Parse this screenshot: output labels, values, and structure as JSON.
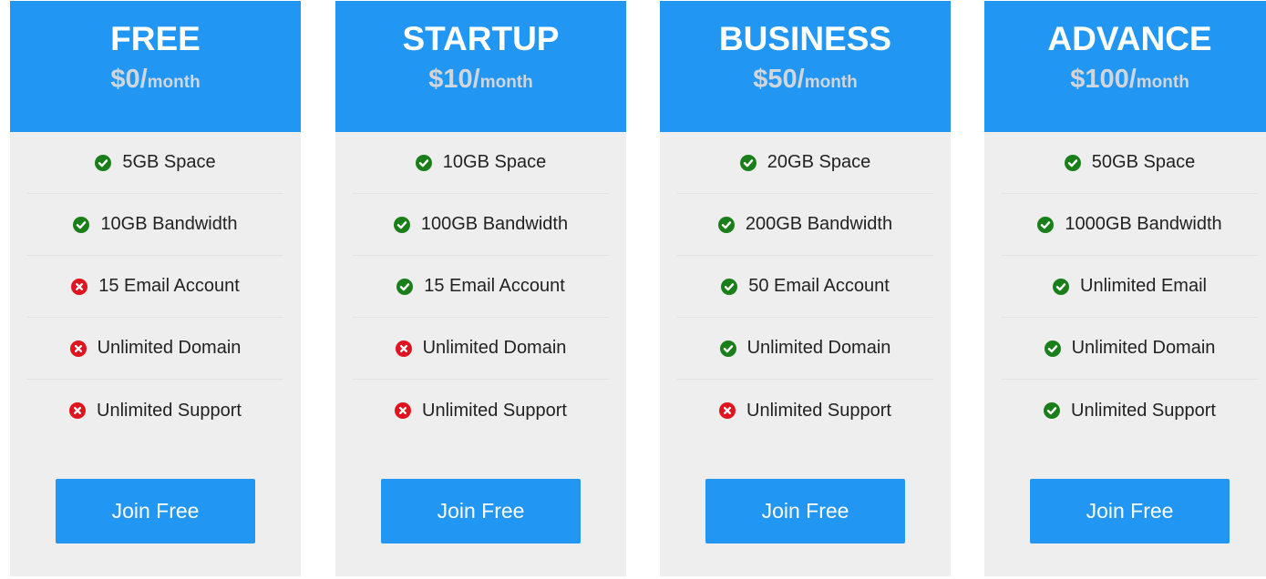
{
  "colors": {
    "accent": "#2196f3",
    "card_background": "#eeeeee",
    "included": "#1a7f1a",
    "excluded": "#e0141e"
  },
  "plans": [
    {
      "name": "FREE",
      "price": "$0/",
      "period": "month",
      "features": [
        {
          "label": "5GB Space",
          "included": true,
          "icon": "check-circle-icon"
        },
        {
          "label": "10GB Bandwidth",
          "included": true,
          "icon": "check-circle-icon"
        },
        {
          "label": "15 Email Account",
          "included": false,
          "icon": "x-circle-icon"
        },
        {
          "label": "Unlimited Domain",
          "included": false,
          "icon": "x-circle-icon"
        },
        {
          "label": "Unlimited Support",
          "included": false,
          "icon": "x-circle-icon"
        }
      ],
      "button_label": "Join Free"
    },
    {
      "name": "STARTUP",
      "price": "$10/",
      "period": "month",
      "features": [
        {
          "label": "10GB Space",
          "included": true,
          "icon": "check-circle-icon"
        },
        {
          "label": "100GB Bandwidth",
          "included": true,
          "icon": "check-circle-icon"
        },
        {
          "label": "15 Email Account",
          "included": true,
          "icon": "check-circle-icon"
        },
        {
          "label": "Unlimited Domain",
          "included": false,
          "icon": "x-circle-icon"
        },
        {
          "label": "Unlimited Support",
          "included": false,
          "icon": "x-circle-icon"
        }
      ],
      "button_label": "Join Free"
    },
    {
      "name": "BUSINESS",
      "price": "$50/",
      "period": "month",
      "features": [
        {
          "label": "20GB Space",
          "included": true,
          "icon": "check-circle-icon"
        },
        {
          "label": "200GB Bandwidth",
          "included": true,
          "icon": "check-circle-icon"
        },
        {
          "label": "50 Email Account",
          "included": true,
          "icon": "check-circle-icon"
        },
        {
          "label": "Unlimited Domain",
          "included": true,
          "icon": "check-circle-icon"
        },
        {
          "label": "Unlimited Support",
          "included": false,
          "icon": "x-circle-icon"
        }
      ],
      "button_label": "Join Free"
    },
    {
      "name": "ADVANCE",
      "price": "$100/",
      "period": "month",
      "features": [
        {
          "label": "50GB Space",
          "included": true,
          "icon": "check-circle-icon"
        },
        {
          "label": "1000GB Bandwidth",
          "included": true,
          "icon": "check-circle-icon"
        },
        {
          "label": "Unlimited Email",
          "included": true,
          "icon": "check-circle-icon"
        },
        {
          "label": "Unlimited Domain",
          "included": true,
          "icon": "check-circle-icon"
        },
        {
          "label": "Unlimited Support",
          "included": true,
          "icon": "check-circle-icon"
        }
      ],
      "button_label": "Join Free"
    }
  ]
}
